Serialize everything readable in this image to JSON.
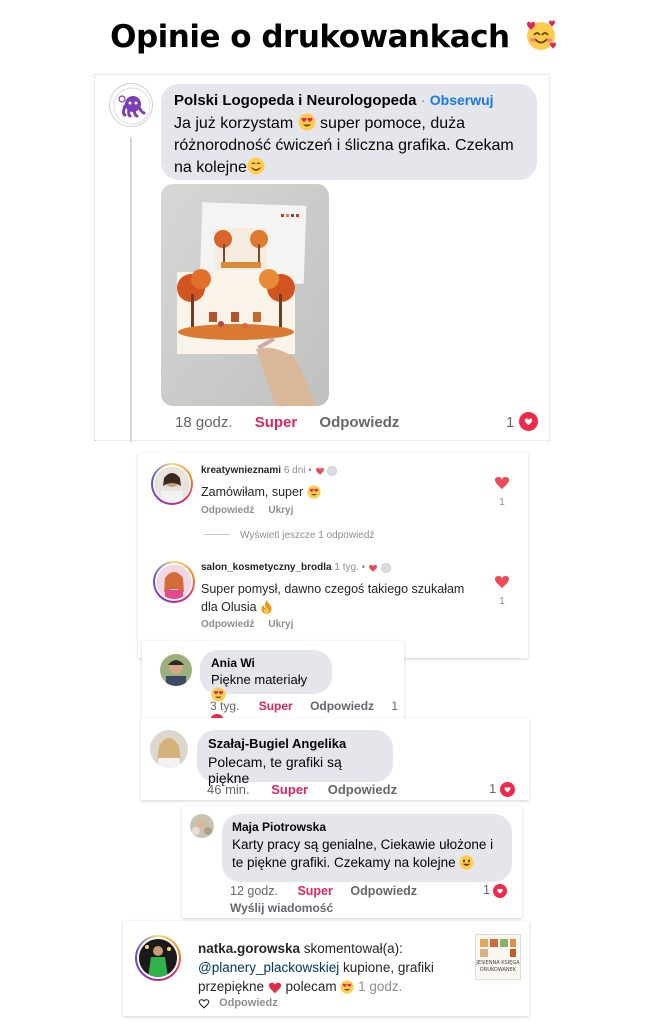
{
  "page": {
    "title": "Opinie o drukowankach"
  },
  "card1": {
    "name": "Polski Logopeda i Neurologopeda",
    "separator": "·",
    "follow": "Obserwuj",
    "text_a": "Ja już korzystam ",
    "text_b": " super pomoce, duża różnorodność ćwiczeń i śliczna grafika. Czekam na kolejne",
    "time": "18 godz.",
    "like": "Super",
    "reply": "Odpowiedz",
    "reactions": "1"
  },
  "card2": {
    "c1": {
      "user": "kreatywnieznami",
      "time": "6 dni",
      "text": "Zamówiłam, super ",
      "reply": "Odpowiedź",
      "hide": "Ukryj",
      "likes": "1"
    },
    "more": "Wyświetl jeszcze 1 odpowiedź",
    "c2": {
      "user": "salon_kosmetyczny_brodla",
      "time": "1 tyg.",
      "text": "Super pomysł, dawno czegoś takiego szukałam dla Olusia ",
      "reply": "Odpowiedź",
      "hide": "Ukryj",
      "likes": "1"
    }
  },
  "card3": {
    "name": "Ania Wi",
    "text": "Piękne materiały ",
    "time": "3 tyg.",
    "like": "Super",
    "reply": "Odpowiedz",
    "reactions": "1"
  },
  "card4": {
    "name": "Szałaj-Bugiel Angelika",
    "text": "Polecam, te grafiki są piękne",
    "time": "46 min.",
    "like": "Super",
    "reply": "Odpowiedz",
    "reactions": "1"
  },
  "card5": {
    "name": "Maja Piotrowska",
    "text": "Karty pracy są genialne, Ciekawie ułożone i te piękne grafiki. Czekamy na kolejne ",
    "time": "12 godz.",
    "like": "Super",
    "reply": "Odpowiedz",
    "reactions": "1",
    "send": "Wyślij wiadomość"
  },
  "card6": {
    "user": "natka.gorowska",
    "action": " skomentował(a):",
    "mention": "@planery_plackowskiej",
    "text_a": " kupione, grafiki przepiękne ",
    "text_b": " polecam ",
    "time": " 1 godz.",
    "reply": "Odpowiedz",
    "thumb_text": "JESIENNA KSIĘGA DRUKOWANEK"
  },
  "colors": {
    "facebook_blue": "#1877f2",
    "like_red": "#e0245e",
    "bubble": "#e4e6eb",
    "heart": "#f02849"
  }
}
